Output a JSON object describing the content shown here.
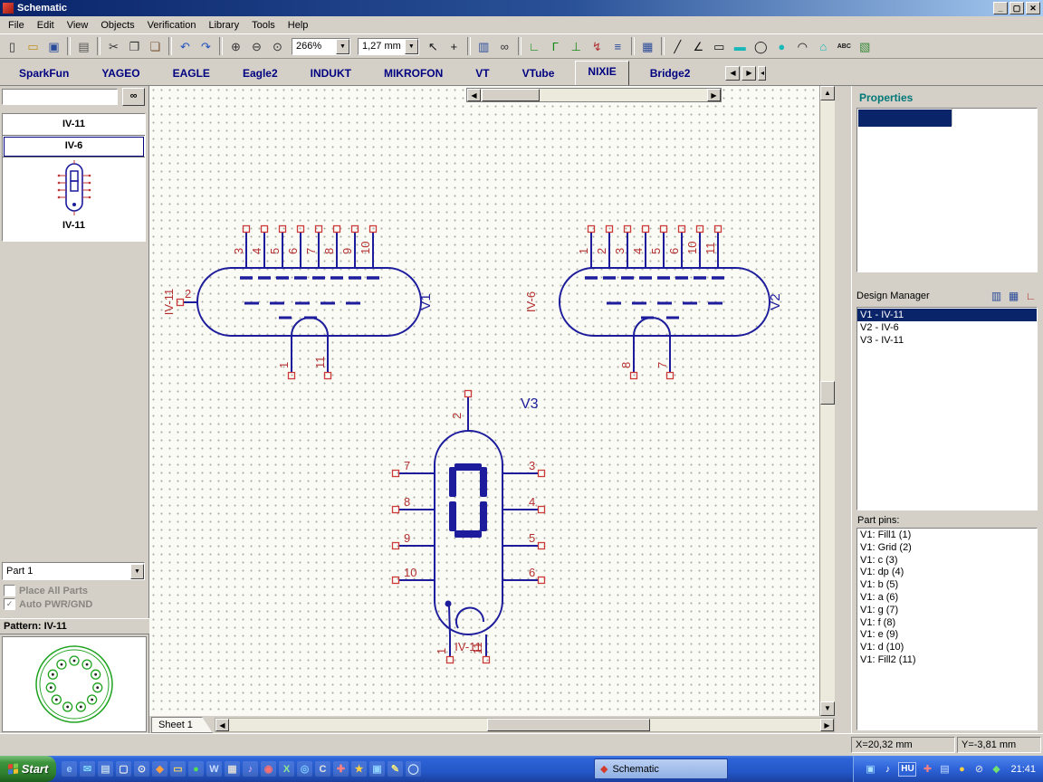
{
  "window": {
    "title": "Schematic",
    "minimize": "_",
    "maximize": "▢",
    "close": "✕"
  },
  "menu": [
    "File",
    "Edit",
    "View",
    "Objects",
    "Verification",
    "Library",
    "Tools",
    "Help"
  ],
  "toolbar": {
    "zoom": "266%",
    "grid": "1,27 mm",
    "icons_a": [
      {
        "name": "new-document",
        "g": "▯",
        "c": "#333333"
      },
      {
        "name": "open-folder",
        "g": "▭",
        "c": "#C09018"
      },
      {
        "name": "save",
        "g": "▣",
        "c": "#2A4A9A"
      },
      {
        "sep": true
      },
      {
        "name": "print",
        "g": "▤",
        "c": "#555555"
      },
      {
        "sep": true
      },
      {
        "name": "cut",
        "g": "✂",
        "c": "#333333"
      },
      {
        "name": "copy",
        "g": "❐",
        "c": "#333333"
      },
      {
        "name": "paste",
        "g": "❏",
        "c": "#7A5230"
      },
      {
        "sep": true
      },
      {
        "name": "undo",
        "g": "↶",
        "c": "#2050C0"
      },
      {
        "name": "redo",
        "g": "↷",
        "c": "#2050C0"
      },
      {
        "sep": true
      },
      {
        "name": "zoom-in",
        "g": "⊕",
        "c": "#333333"
      },
      {
        "name": "zoom-out",
        "g": "⊖",
        "c": "#333333"
      },
      {
        "name": "zoom-window",
        "g": "⊙",
        "c": "#333333"
      }
    ],
    "icons_b": [
      {
        "name": "select-tool",
        "g": "↖",
        "c": "#111111"
      },
      {
        "name": "crosshair-tool",
        "g": "+",
        "c": "#111111"
      },
      {
        "sep": true
      },
      {
        "name": "component-list",
        "g": "▥",
        "c": "#2A4A9A"
      },
      {
        "name": "find",
        "g": "∞",
        "c": "#333333"
      },
      {
        "sep": true
      },
      {
        "name": "place-wire",
        "g": "∟",
        "c": "#128A12"
      },
      {
        "name": "place-bus",
        "g": "Γ",
        "c": "#128A12"
      },
      {
        "name": "bus-connection",
        "g": "⊥",
        "c": "#128A12"
      },
      {
        "name": "net-port",
        "g": "↯",
        "c": "#B03030"
      },
      {
        "name": "place-net",
        "g": "≡",
        "c": "#2A4A9A"
      },
      {
        "sep": true
      },
      {
        "name": "spreadsheet",
        "g": "▦",
        "c": "#2A4A9A"
      },
      {
        "sep": true
      },
      {
        "name": "draw-line",
        "g": "╱",
        "c": "#111111"
      },
      {
        "name": "draw-polyline",
        "g": "∠",
        "c": "#111111"
      },
      {
        "name": "draw-rect",
        "g": "▭",
        "c": "#111111"
      },
      {
        "name": "draw-filled-rect",
        "g": "▬",
        "c": "#18B8B8"
      },
      {
        "name": "draw-ellipse",
        "g": "◯",
        "c": "#111111"
      },
      {
        "name": "draw-filled-ellipse",
        "g": "●",
        "c": "#18B8B8"
      },
      {
        "name": "draw-arc",
        "g": "◠",
        "c": "#111111"
      },
      {
        "name": "draw-polygon",
        "g": "⌂",
        "c": "#18B8B8"
      },
      {
        "name": "text-tool",
        "g": "ABC",
        "c": "#111111",
        "small": true
      },
      {
        "name": "image-tool",
        "g": "▧",
        "c": "#3A8A3A"
      }
    ]
  },
  "library_tabs": {
    "active": "NIXIE",
    "tabs": [
      "SparkFun",
      "YAGEO",
      "EAGLE",
      "Eagle2",
      "INDUKT",
      "MIKROFON",
      "VT",
      "VTube",
      "NIXIE",
      "Bridge2"
    ],
    "scroll_left": "◀",
    "scroll_right": "▶",
    "more": "◂"
  },
  "left_panel": {
    "components": {
      "items": [
        "IV-11",
        "IV-6"
      ],
      "selected": 1
    },
    "preview_caption": "IV-11",
    "part_combo": "Part 1",
    "place_all_parts": "Place All Parts",
    "auto_pwr_gnd": "Auto PWR/GND",
    "pattern_header": "Pattern: IV-11"
  },
  "canvas": {
    "sheet_tab": "Sheet 1",
    "symbols": [
      {
        "ref": "V1",
        "value": "IV-11",
        "top_pins": [
          "3",
          "4",
          "5",
          "6",
          "7",
          "8",
          "9",
          "10"
        ],
        "left_pins": [
          "2"
        ],
        "bottom_pins": [
          "1",
          "11"
        ]
      },
      {
        "ref": "V2",
        "value": "IV-6",
        "top_pins": [
          "1",
          "2",
          "3",
          "4",
          "5",
          "6",
          "10",
          "11"
        ],
        "left_pins": [],
        "bottom_pins": [
          "8",
          "7"
        ]
      },
      {
        "ref": "V3",
        "value": "IV-11",
        "top_pins": [
          "2"
        ],
        "left_pins": [
          "7",
          "8",
          "9",
          "10"
        ],
        "right_pins": [
          "3",
          "4",
          "5",
          "6"
        ],
        "bottom_pins": [
          "1",
          "11"
        ],
        "digit": "0"
      }
    ]
  },
  "right_panel": {
    "properties_title": "Properties",
    "design_manager": {
      "title": "Design Manager",
      "items": [
        "V1 - IV-11",
        "V2 - IV-6",
        "V3 - IV-11"
      ],
      "selected": 0,
      "icons": [
        {
          "name": "dm-components",
          "g": "▥",
          "c": "#2A4A9A"
        },
        {
          "name": "dm-table",
          "g": "▦",
          "c": "#2A4A9A"
        },
        {
          "name": "dm-nets",
          "g": "∟",
          "c": "#B03030"
        }
      ]
    },
    "part_pins": {
      "title": "Part pins:",
      "items": [
        "V1: Fill1 (1)",
        "V1: Grid (2)",
        "V1: c (3)",
        "V1: dp (4)",
        "V1: b (5)",
        "V1: a (6)",
        "V1: g (7)",
        "V1: f (8)",
        "V1: e (9)",
        "V1: d (10)",
        "V1: Fill2 (11)"
      ]
    }
  },
  "status": {
    "x": "X=20,32 mm",
    "y": "Y=-3,81 mm"
  },
  "taskbar": {
    "start": "Start",
    "task": "Schematic",
    "lang": "HU",
    "time": "21:41",
    "quick_launch": [
      {
        "name": "quicklaunch-internet",
        "g": "e",
        "c": "#9CC8FF"
      },
      {
        "name": "quicklaunch-mail",
        "g": "✉",
        "c": "#7FD4FF"
      },
      {
        "name": "quicklaunch-show-desktop",
        "g": "▤",
        "c": "#B8D0E8"
      },
      {
        "name": "quicklaunch-document",
        "g": "▢",
        "c": "#F0F0F0"
      },
      {
        "name": "quicklaunch-search",
        "g": "⊙",
        "c": "#E8E8E8"
      },
      {
        "name": "quicklaunch-media-player",
        "g": "◆",
        "c": "#FFA040"
      },
      {
        "name": "quicklaunch-folder",
        "g": "▭",
        "c": "#F0D060"
      },
      {
        "name": "quicklaunch-messenger",
        "g": "●",
        "c": "#50E050"
      },
      {
        "name": "quicklaunch-word",
        "g": "W",
        "c": "#C8DCFF"
      },
      {
        "name": "quicklaunch-grid-app",
        "g": "▦",
        "c": "#D8D8D8"
      },
      {
        "name": "quicklaunch-music",
        "g": "♪",
        "c": "#E8B0F8"
      },
      {
        "name": "quicklaunch-media-red",
        "g": "◉",
        "c": "#FF7070"
      },
      {
        "name": "quicklaunch-excel",
        "g": "X",
        "c": "#90E890"
      },
      {
        "name": "quicklaunch-globe",
        "g": "◎",
        "c": "#80C8FF"
      },
      {
        "name": "quicklaunch-console",
        "g": "C",
        "c": "#E0E0E0"
      },
      {
        "name": "quicklaunch-first-aid",
        "g": "✚",
        "c": "#FF8080"
      },
      {
        "name": "quicklaunch-star",
        "g": "★",
        "c": "#FFD040"
      },
      {
        "name": "quicklaunch-chart",
        "g": "▣",
        "c": "#90D0FF"
      },
      {
        "name": "quicklaunch-notes",
        "g": "✎",
        "c": "#F0E880"
      },
      {
        "name": "quicklaunch-cd",
        "g": "◯",
        "c": "#D0E8FF"
      }
    ],
    "tray_before": [
      {
        "name": "tray-network",
        "g": "▣",
        "c": "#A8E0FF"
      },
      {
        "name": "tray-volume",
        "g": "♪",
        "c": "#FFFFFF"
      }
    ],
    "tray_after": [
      {
        "name": "tray-antivirus",
        "g": "✚",
        "c": "#FF8080"
      },
      {
        "name": "tray-display",
        "g": "▤",
        "c": "#C8E0FF"
      },
      {
        "name": "tray-battery",
        "g": "●",
        "c": "#FFD040"
      },
      {
        "name": "tray-blocked",
        "g": "⊘",
        "c": "#E8E8E8"
      },
      {
        "name": "tray-sync",
        "g": "◆",
        "c": "#70E070"
      }
    ]
  }
}
